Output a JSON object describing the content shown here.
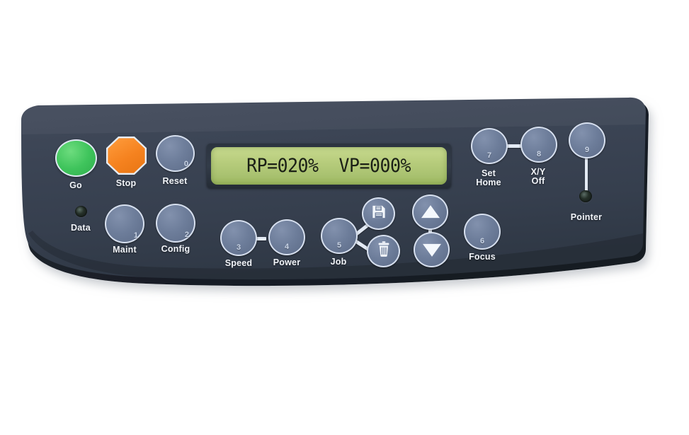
{
  "device": {
    "kind": "laser-engraver-control-panel",
    "panel_color": "#3b4352",
    "button_color": "#6d7d9a",
    "button_ring_color": "#d7e0ef",
    "label_color": "#f2f5fa"
  },
  "display": {
    "name": "lcd-display",
    "line1": "RP=020%  VP=000%",
    "screen_color": "#b5ca77",
    "text_color": "#1b2016",
    "readouts": [
      {
        "key": "RP",
        "value": "020",
        "unit": "%"
      },
      {
        "key": "VP",
        "value": "000",
        "unit": "%"
      }
    ]
  },
  "buttons": {
    "go": {
      "label": "Go",
      "number": "",
      "color": "#3fc45c",
      "shape": "circle"
    },
    "stop": {
      "label": "Stop",
      "number": "",
      "color": "#f5821f",
      "shape": "octagon"
    },
    "reset": {
      "label": "Reset",
      "number": "0",
      "shape": "circle"
    },
    "maint": {
      "label": "Maint",
      "number": "1",
      "shape": "circle"
    },
    "config": {
      "label": "Config",
      "number": "2",
      "shape": "circle"
    },
    "speed": {
      "label": "Speed",
      "number": "3",
      "shape": "circle"
    },
    "power": {
      "label": "Power",
      "number": "4",
      "shape": "circle"
    },
    "job": {
      "label": "Job",
      "number": "5",
      "shape": "circle"
    },
    "save": {
      "label": "",
      "number": "",
      "icon": "floppy-disk-icon",
      "shape": "circle"
    },
    "delete": {
      "label": "",
      "number": "",
      "icon": "trash-can-icon",
      "shape": "circle"
    },
    "up": {
      "label": "",
      "number": "",
      "icon": "arrow-up-icon",
      "shape": "circle"
    },
    "down": {
      "label": "",
      "number": "",
      "icon": "arrow-down-icon",
      "shape": "circle"
    },
    "focus": {
      "label": "Focus",
      "number": "6",
      "shape": "circle"
    },
    "set_home": {
      "label": "Set\nHome",
      "number": "7",
      "shape": "circle"
    },
    "xy_off": {
      "label": "X/Y\nOff",
      "number": "8",
      "shape": "circle"
    },
    "pointer_key": {
      "label": "",
      "number": "9",
      "shape": "circle"
    }
  },
  "indicators": {
    "data": {
      "label": "Data",
      "state": "off"
    },
    "pointer": {
      "label": "Pointer",
      "state": "off"
    }
  }
}
